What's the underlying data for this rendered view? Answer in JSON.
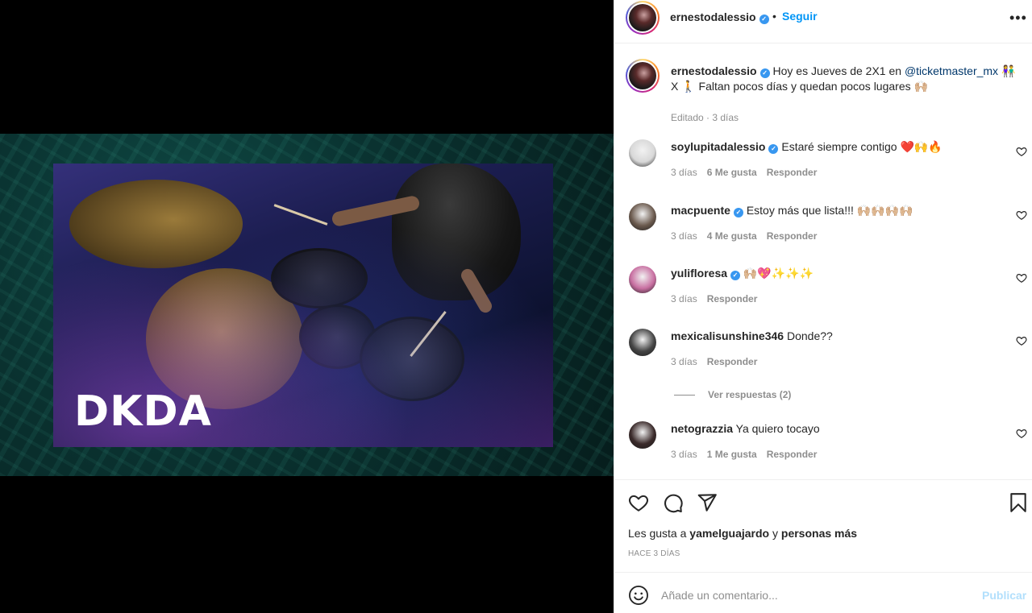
{
  "media": {
    "overlay_text": "DKDA"
  },
  "header": {
    "username": "ernestodalessio",
    "separator": "•",
    "follow_label": "Seguir",
    "more_label": "•••"
  },
  "caption": {
    "username": "ernestodalessio",
    "text_before": "Hoy es Jueves de 2X1 en ",
    "mention": "@ticketmaster_mx",
    "text_after": " 👫 X 🚶 Faltan pocos días y quedan pocos lugares 🙌🏼",
    "meta": "Editado · 3 días"
  },
  "comments": [
    {
      "username": "soylupitadalessio",
      "verified": true,
      "text": "Estaré siempre contigo ❤️🙌🔥",
      "time": "3 días",
      "likes": "6 Me gusta",
      "reply": "Responder",
      "avatar_color": "#d8d8d8"
    },
    {
      "username": "macpuente",
      "verified": true,
      "text": "Estoy más que lista!!! 🙌🏼🙌🏼🙌🏼🙌🏼",
      "time": "3 días",
      "likes": "4 Me gusta",
      "reply": "Responder",
      "avatar_color": "#6b5a4e"
    },
    {
      "username": "yulifloresa",
      "verified": true,
      "text": "🙌🏼💖✨✨✨",
      "time": "3 días",
      "likes": "",
      "reply": "Responder",
      "avatar_color": "#c86fa1"
    },
    {
      "username": "mexicalisunshine346",
      "verified": false,
      "text": "Donde??",
      "time": "3 días",
      "likes": "",
      "reply": "Responder",
      "avatar_color": "#444444"
    },
    {
      "username": "netograzzia",
      "verified": false,
      "text": "Ya quiero tocayo",
      "time": "3 días",
      "likes": "1 Me gusta",
      "reply": "Responder",
      "avatar_color": "#3a2a2a"
    }
  ],
  "view_replies": "Ver respuestas (2)",
  "likes": {
    "prefix": "Les gusta a ",
    "user": "yamelguajardo",
    "connector": " y ",
    "others": "personas más"
  },
  "date_label": "HACE 3 DÍAS",
  "add_comment": {
    "placeholder": "Añade un comentario...",
    "publish_label": "Publicar"
  },
  "colors": {
    "accent": "#0095f6",
    "publish_disabled": "#b2dffc",
    "verified": "#3897f0",
    "meta": "#8e8e8e"
  }
}
